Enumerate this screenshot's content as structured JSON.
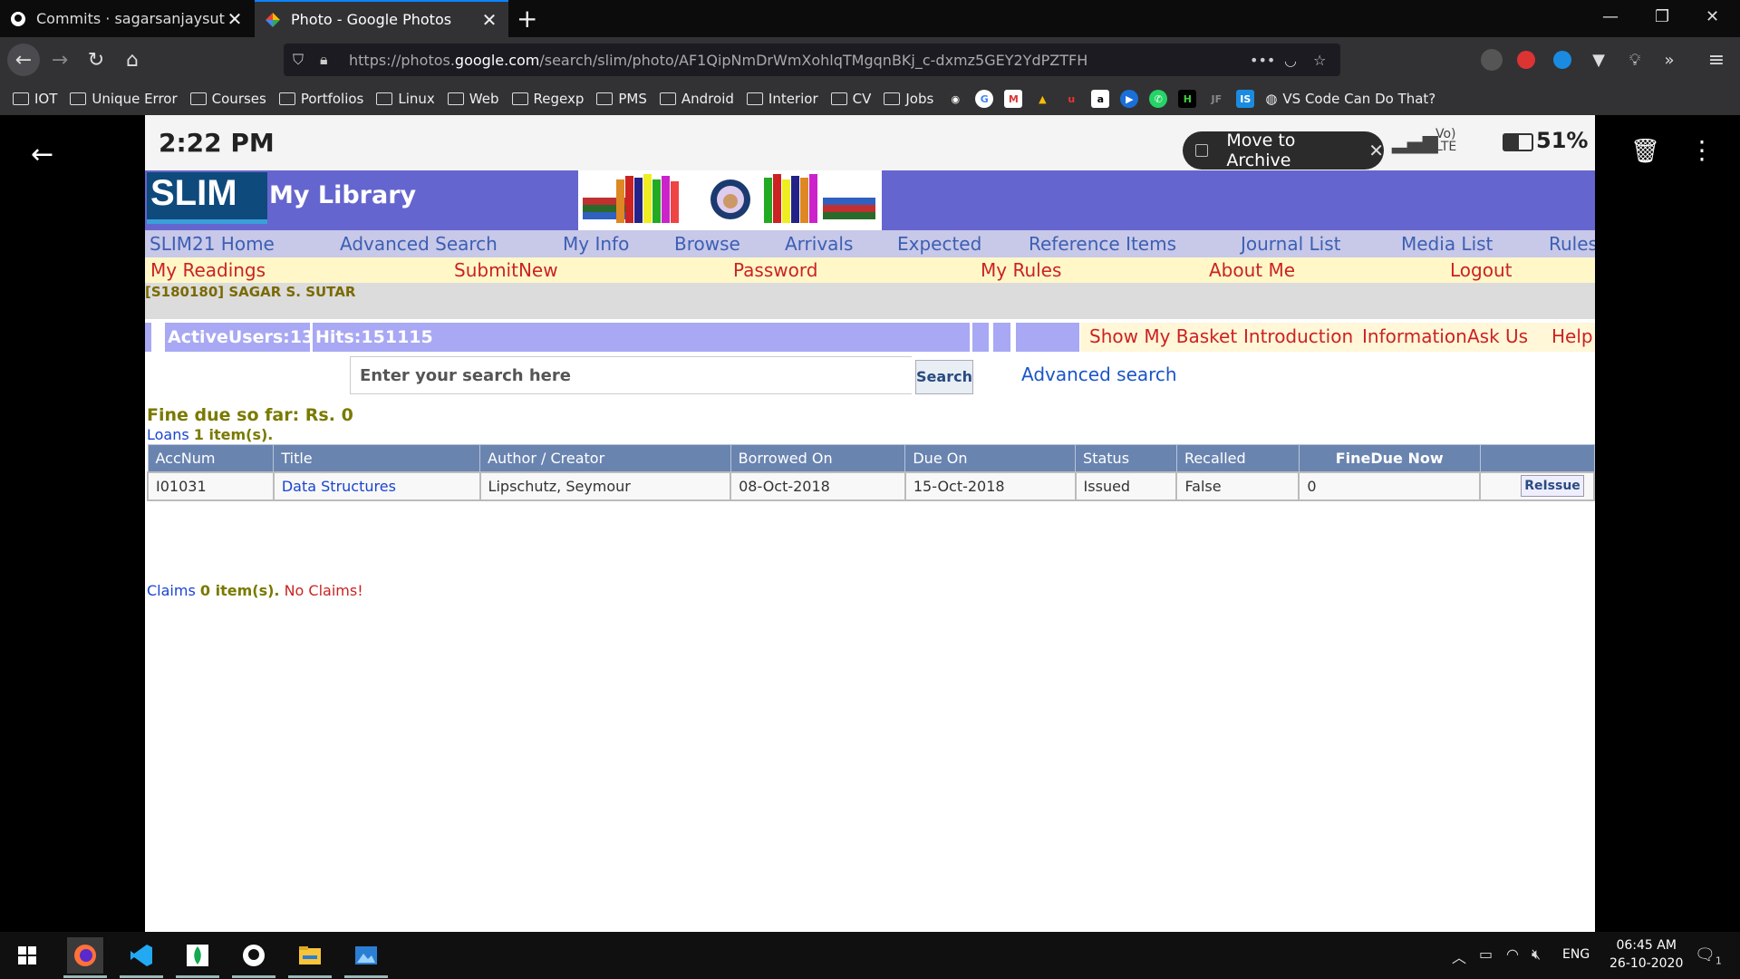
{
  "browser": {
    "tabs": [
      {
        "title": "Commits · sagarsanjaysutar/lib",
        "active": false
      },
      {
        "title": "Photo - Google Photos",
        "active": true
      }
    ],
    "url_prefix": "https://photos.",
    "url_domain": "google.com",
    "url_path": "/search/slim/photo/AF1QipNmDrWmXohlqTMgqnBKj_c-dxmz5GEY2YdPZTFH",
    "bookmarks": [
      "IOT",
      "Unique Error",
      "Courses",
      "Portfolios",
      "Linux",
      "Web",
      "Regexp",
      "PMS",
      "Android",
      "Interior",
      "CV",
      "Jobs"
    ],
    "bookmark_vscode": "VS Code Can Do That?"
  },
  "phone": {
    "time": "2:22 PM",
    "battery": "51%",
    "net": "Vo) LTE",
    "toast": "Move to Archive"
  },
  "slim": {
    "logo": "SLIM",
    "title": "My Library",
    "nav1": [
      "SLIM21 Home",
      "Advanced Search",
      "My Info",
      "Browse",
      "Arrivals",
      "Expected",
      "Reference Items",
      "Journal List",
      "Media List",
      "Rules"
    ],
    "nav2": [
      "My Readings",
      "SubmitNew",
      "Password",
      "My Rules",
      "About Me",
      "Logout"
    ],
    "user": "[S180180] SAGAR S. SUTAR",
    "active_users": "ActiveUsers:13",
    "hits": "Hits:151115",
    "info_links": [
      "Show My Basket",
      "Introduction",
      "Information",
      "Ask Us",
      "Help"
    ],
    "search_placeholder": "Enter your search here",
    "search_button": "Search",
    "advanced_search": "Advanced search",
    "fine": "Fine due so far: Rs. 0",
    "loans_label": "Loans",
    "loans_count": "1 item(s).",
    "table_headers": [
      "AccNum",
      "Title",
      "Author / Creator",
      "Borrowed On",
      "Due On",
      "Status",
      "Recalled",
      "FineDue Now",
      ""
    ],
    "loan_row": {
      "accnum": "I01031",
      "title": "Data Structures",
      "author": "Lipschutz, Seymour",
      "borrowed": "08-Oct-2018",
      "due": "15-Oct-2018",
      "status": "Issued",
      "recalled": "False",
      "fine": "0",
      "action": "ReIssue"
    },
    "claims_label": "Claims",
    "claims_count": "0 item(s).",
    "claims_msg": "No Claims!"
  },
  "taskbar": {
    "lang": "ENG",
    "time": "06:45 AM",
    "date": "26-10-2020",
    "notif_count": "1"
  },
  "colors": {
    "slim_header": "#6565cf",
    "nav_link": "#3c5fb4",
    "nav2_link": "#c22222",
    "table_header": "#6a84b0",
    "info_bar": "#a8a8f4"
  }
}
